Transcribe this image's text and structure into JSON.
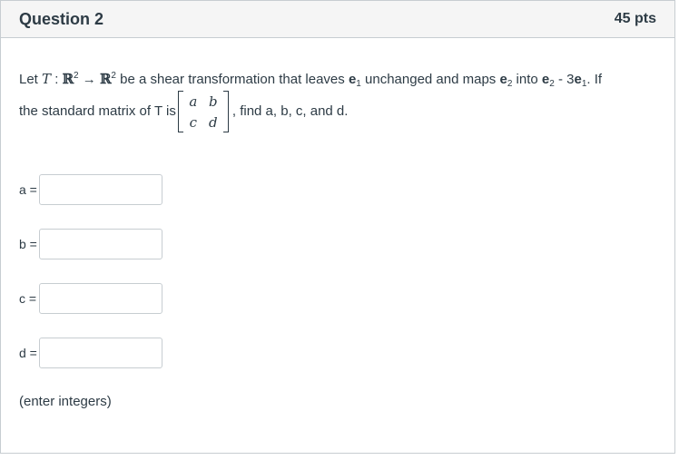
{
  "question": {
    "title": "Question 2",
    "points": "45 pts"
  },
  "prompt": {
    "let": "Let ",
    "T": "T",
    "colon": " : ",
    "R": "ℝ",
    "exp": "2",
    "arrow": " → ",
    "mid": " be a shear transformation that leaves ",
    "e": "e",
    "one": "1",
    "two": "2",
    "unchanged": " unchanged and maps ",
    "into": " into ",
    "minus": " - 3",
    "if": ". If",
    "line2_start": "the standard matrix of T is",
    "line2_end": ", find a, b, c, and d."
  },
  "matrix": {
    "a": "a",
    "b": "b",
    "c": "c",
    "d": "d"
  },
  "answers": [
    {
      "label": "a =",
      "value": ""
    },
    {
      "label": "b =",
      "value": ""
    },
    {
      "label": "c =",
      "value": ""
    },
    {
      "label": "d =",
      "value": ""
    }
  ],
  "note": "(enter integers)"
}
